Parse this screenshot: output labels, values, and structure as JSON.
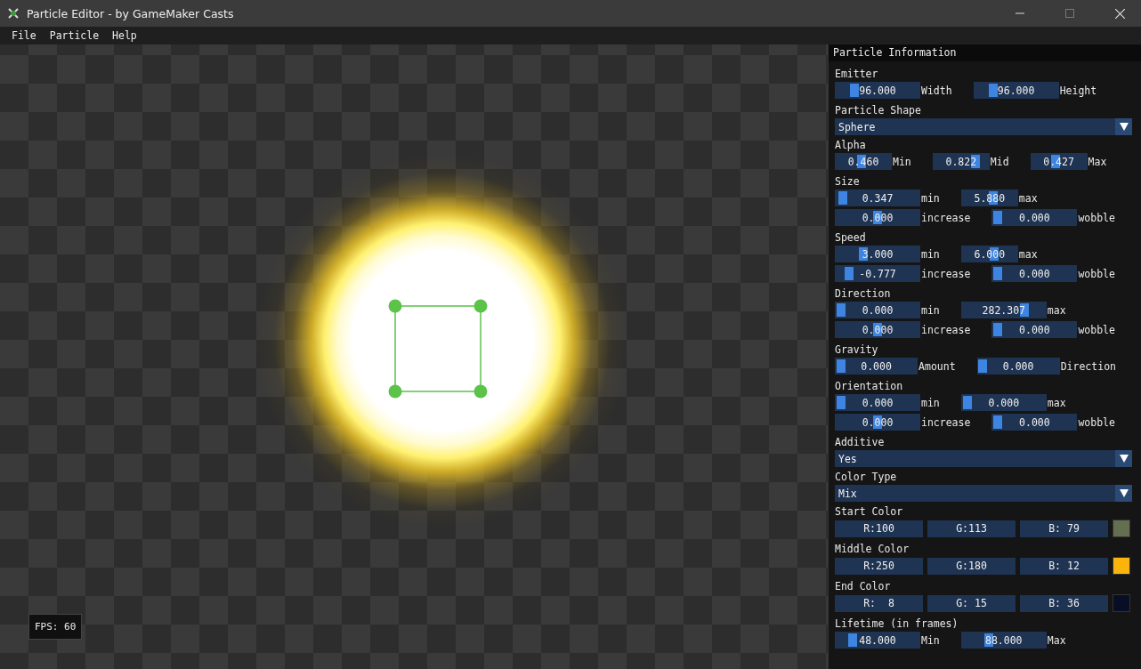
{
  "window": {
    "title": "Particle Editor - by GameMaker Casts"
  },
  "menu": [
    {
      "label": "File"
    },
    {
      "label": "Particle"
    },
    {
      "label": "Help"
    }
  ],
  "canvas": {
    "fps": "FPS: 60"
  },
  "panel": {
    "title": "Particle Information",
    "sections": [
      {
        "label": "Emitter",
        "kind": "sliders",
        "rows": [
          [
            {
              "value": "96.000",
              "level": 0.2,
              "label": "Width",
              "kind": "wide"
            },
            {
              "value": "96.000",
              "level": 0.2,
              "label": "Height",
              "kind": "wide"
            }
          ]
        ]
      },
      {
        "label": "Particle Shape",
        "kind": "dropdown",
        "value": "Sphere"
      },
      {
        "label": "Alpha",
        "kind": "sliders",
        "rows": [
          [
            {
              "value": "0.460",
              "level": 0.46,
              "label": "Min",
              "kind": "narrow"
            },
            {
              "value": "0.822",
              "level": 0.8,
              "label": "Mid",
              "kind": "narrow"
            },
            {
              "value": "0.427",
              "level": 0.43,
              "label": "Max",
              "kind": "narrow"
            }
          ]
        ]
      },
      {
        "label": "Size",
        "kind": "sliders",
        "rows": [
          [
            {
              "value": "0.347",
              "level": 0.05,
              "label": "min",
              "kind": "wide"
            },
            {
              "value": "5.880",
              "level": 0.57,
              "label": "max",
              "kind": "narrow"
            }
          ],
          [
            {
              "value": "0.000",
              "level": 0.5,
              "label": "increase",
              "kind": "wide"
            },
            {
              "value": "0.000",
              "level": 0.02,
              "label": "wobble",
              "kind": "wide"
            }
          ]
        ]
      },
      {
        "label": "Speed",
        "kind": "sliders",
        "rows": [
          [
            {
              "value": "3.000",
              "level": 0.31,
              "label": "min",
              "kind": "wide"
            },
            {
              "value": "6.000",
              "level": 0.59,
              "label": "max",
              "kind": "narrow"
            }
          ],
          [
            {
              "value": "-0.777",
              "level": 0.13,
              "label": "increase",
              "kind": "wide"
            },
            {
              "value": "0.000",
              "level": 0.02,
              "label": "wobble",
              "kind": "wide"
            }
          ]
        ]
      },
      {
        "label": "Direction",
        "kind": "sliders",
        "rows": [
          [
            {
              "value": "0.000",
              "level": 0.02,
              "label": "min",
              "kind": "wide"
            },
            {
              "value": "282.307",
              "level": 0.77,
              "label": "max",
              "kind": "wide"
            }
          ],
          [
            {
              "value": "0.000",
              "level": 0.5,
              "label": "increase",
              "kind": "wide"
            },
            {
              "value": "0.000",
              "level": 0.02,
              "label": "wobble",
              "kind": "wide"
            }
          ]
        ]
      },
      {
        "label": "Gravity",
        "kind": "sliders",
        "rows": [
          [
            {
              "value": "0.000",
              "level": 0.02,
              "label": "Amount",
              "kind": "wide"
            },
            {
              "value": "0.000",
              "level": 0.02,
              "label": "Direction",
              "kind": "wide"
            }
          ]
        ]
      },
      {
        "label": "Orientation",
        "kind": "sliders",
        "rows": [
          [
            {
              "value": "0.000",
              "level": 0.02,
              "label": "min",
              "kind": "wide"
            },
            {
              "value": "0.000",
              "level": 0.02,
              "label": "max",
              "kind": "wide"
            }
          ],
          [
            {
              "value": "0.000",
              "level": 0.5,
              "label": "increase",
              "kind": "wide"
            },
            {
              "value": "0.000",
              "level": 0.02,
              "label": "wobble",
              "kind": "wide"
            }
          ]
        ]
      },
      {
        "label": "Additive",
        "kind": "dropdown",
        "value": "Yes"
      },
      {
        "label": "Color Type",
        "kind": "dropdown",
        "value": "Mix"
      },
      {
        "label": "Start Color",
        "kind": "color",
        "channels": [
          "R:100",
          "G:113",
          "B: 79"
        ],
        "color": "#646f4f"
      },
      {
        "label": "Middle Color",
        "kind": "color",
        "channels": [
          "R:250",
          "G:180",
          "B: 12"
        ],
        "color": "#fab40c"
      },
      {
        "label": "End Color",
        "kind": "color",
        "channels": [
          "R:  8",
          "G: 15",
          "B: 36"
        ],
        "color": "#080f24"
      },
      {
        "label": "Lifetime (in frames)",
        "kind": "sliders",
        "rows": [
          [
            {
              "value": "48.000",
              "level": 0.17,
              "label": "Min",
              "kind": "wide"
            },
            {
              "value": "88.000",
              "level": 0.3,
              "label": "Max",
              "kind": "wide"
            }
          ]
        ]
      }
    ]
  }
}
